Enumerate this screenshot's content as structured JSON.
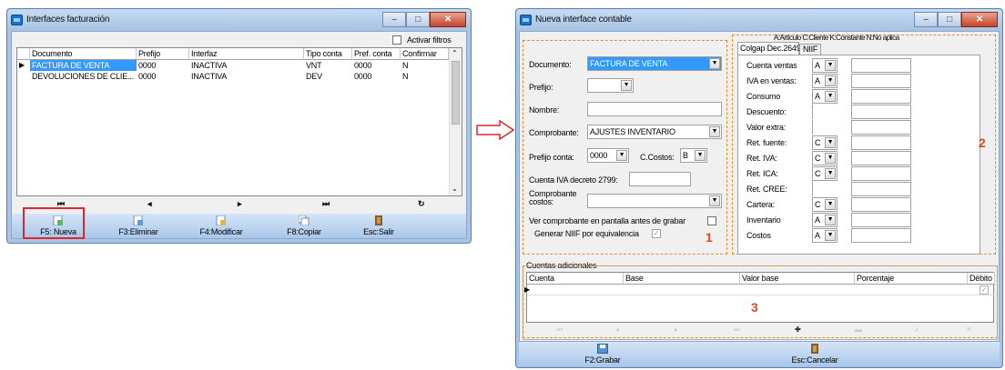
{
  "left_window": {
    "title": "Interfaces facturación",
    "activar_filtros": "Activar filtros",
    "columns": [
      "Documento",
      "Prefijo",
      "Interfaz",
      "Tipo conta",
      "Pref. conta",
      "Confirmar"
    ],
    "rows": [
      [
        "FACTURA DE VENTA",
        "0000",
        "INACTIVA",
        "VNT",
        "0000",
        "N"
      ],
      [
        "DEVOLUCIONES DE CLIE...",
        "0000",
        "INACTIVA",
        "DEV",
        "0000",
        "N"
      ]
    ],
    "nav": {
      "first": "⏮",
      "prev": "◂",
      "next": "▸",
      "last": "⏭",
      "refresh": "↻"
    },
    "toolbar": {
      "nueva": "F5: Nueva",
      "eliminar": "F3:Eliminar",
      "modificar": "F4:Modificar",
      "copiar": "F8:Copiar",
      "salir": "Esc:Salir"
    }
  },
  "arrow_icon": "right-arrow-icon",
  "right_window": {
    "title": "Nueva interface contable",
    "section1": {
      "documento_label": "Documento:",
      "documento_value": "FACTURA DE VENTA",
      "prefijo_label": "Prefijo:",
      "prefijo_value": "",
      "nombre_label": "Nombre:",
      "nombre_value": "",
      "comprobante_label": "Comprobante:",
      "comprobante_value": "AJUSTES INVENTARIO",
      "prefijo_conta_label": "Prefijo conta:",
      "prefijo_conta_value": "0000",
      "ccostos_label": "C.Costos:",
      "ccostos_value": "B",
      "cuenta_iva_label": "Cuenta IVA decreto 2799:",
      "cuenta_iva_value": "",
      "comprobante_costos_label_1": "Comprobante",
      "comprobante_costos_label_2": "costos:",
      "comprobante_costos_value": "",
      "ver_comprobante_label": "Ver comprobante en pantalla antes de grabar",
      "generar_niif_label": "Generar NIIF por equivalencia",
      "number": "1"
    },
    "section2": {
      "legend": "A:Artículo C:Cliente K:Constante N:No aplica",
      "tabs": [
        "Colgap Dec.2649",
        "NIIF"
      ],
      "rows": [
        {
          "label": "Cuenta ventas",
          "code": "A"
        },
        {
          "label": "IVA en ventas:",
          "code": "A"
        },
        {
          "label": "Consumo",
          "code": "A"
        },
        {
          "label": "Descuento:",
          "code": ""
        },
        {
          "label": "Valor extra:",
          "code": ""
        },
        {
          "label": "Ret. fuente:",
          "code": "C"
        },
        {
          "label": "Ret. IVA:",
          "code": "C"
        },
        {
          "label": "Ret. ICA:",
          "code": "C"
        },
        {
          "label": "Ret. CREE:",
          "code": ""
        },
        {
          "label": "Cartera:",
          "code": "C"
        },
        {
          "label": "Inventario",
          "code": "A"
        },
        {
          "label": "Costos",
          "code": "A"
        }
      ],
      "number": "2"
    },
    "section3": {
      "title": "Cuentas adicionales",
      "columns": [
        "Cuenta",
        "Base",
        "Valor base",
        "Porcentaje",
        "Débito"
      ],
      "number": "3"
    },
    "toolbar": {
      "grabar": "F2:Grabar",
      "cancelar": "Esc:Cancelar"
    }
  },
  "colors": {
    "highlight_box": "#e0262b",
    "dashed": "#ec8b2c",
    "selection": "#3399ff"
  }
}
